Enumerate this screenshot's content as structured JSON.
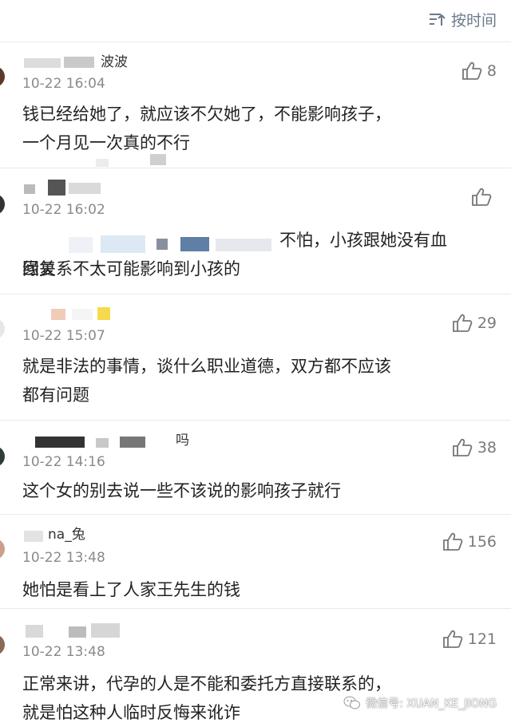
{
  "header": {
    "sort_label": "按时间",
    "sort_icon": "sort-icon"
  },
  "comments": [
    {
      "user": "波波",
      "time": "10-22 16:04",
      "likes": "8",
      "text": "钱已经给她了，就应该不欠她了，不能影响孩子，\n一个月见一次真的不行"
    },
    {
      "user": "",
      "time": "10-22 16:02",
      "likes": "",
      "reply_prefix": "回复",
      "text_suffix": "不怕，小孩跟她没有血\n缘关系不太可能影响到小孩的"
    },
    {
      "user": "",
      "time": "10-22 15:07",
      "likes": "29",
      "text": "就是非法的事情，谈什么职业道德，双方都不应该\n都有问题"
    },
    {
      "user": "吗",
      "time": "10-22 14:16",
      "likes": "38",
      "text": "这个女的别去说一些不该说的影响孩子就行"
    },
    {
      "user": "na_兔",
      "time": "10-22 13:48",
      "likes": "156",
      "text": "她怕是看上了人家王先生的钱"
    },
    {
      "user": "",
      "time": "10-22 13:48",
      "likes": "121",
      "text": "正常来讲，代孕的人是不能和委托方直接联系的，\n就是怕这种人临时反悔来讹诈"
    }
  ],
  "watermark": {
    "text": "微信号: XUAN_KE_JIONG"
  }
}
